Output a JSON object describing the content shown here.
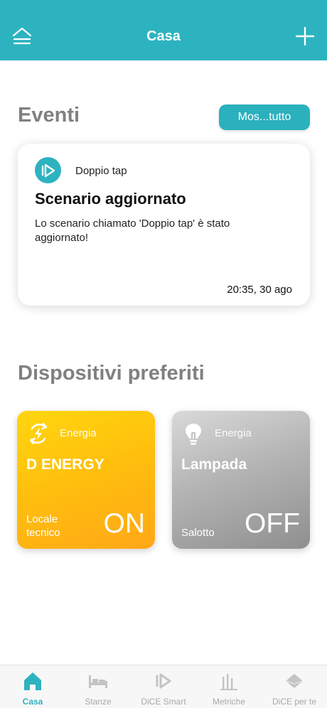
{
  "header": {
    "title": "Casa",
    "menu_icon": "home-menu-icon",
    "add_icon": "plus-icon",
    "color": "#2db3c0"
  },
  "events": {
    "section_title": "Eventi",
    "show_all_label": "Mos...tutto",
    "card": {
      "icon": "scenario-play-icon",
      "source": "Doppio tap",
      "title": "Scenario aggiornato",
      "description": "Lo scenario chiamato 'Doppio tap' è stato aggiornato!",
      "timestamp": "20:35, 30 ago"
    }
  },
  "favorites": {
    "section_title": "Dispositivi preferiti",
    "devices": [
      {
        "category_icon": "energy-icon",
        "category": "Energia",
        "name": "D ENERGY",
        "room": "Locale tecnico",
        "state": "ON",
        "color": "#ffc00d"
      },
      {
        "category_icon": "lightbulb-icon",
        "category": "Energia",
        "name": "Lampada",
        "room": "Salotto",
        "state": "OFF",
        "color": "#b4b4b4"
      }
    ]
  },
  "tabbar": {
    "active_color": "#2db3c0",
    "tabs": [
      {
        "label": "Casa",
        "icon": "home-icon",
        "active": true
      },
      {
        "label": "Stanze",
        "icon": "bed-icon",
        "active": false
      },
      {
        "label": "DiCE Smart",
        "icon": "dice-smart-icon",
        "active": false
      },
      {
        "label": "Metriche",
        "icon": "metrics-icon",
        "active": false
      },
      {
        "label": "DiCE per te",
        "icon": "dice-for-you-icon",
        "active": false
      }
    ]
  }
}
